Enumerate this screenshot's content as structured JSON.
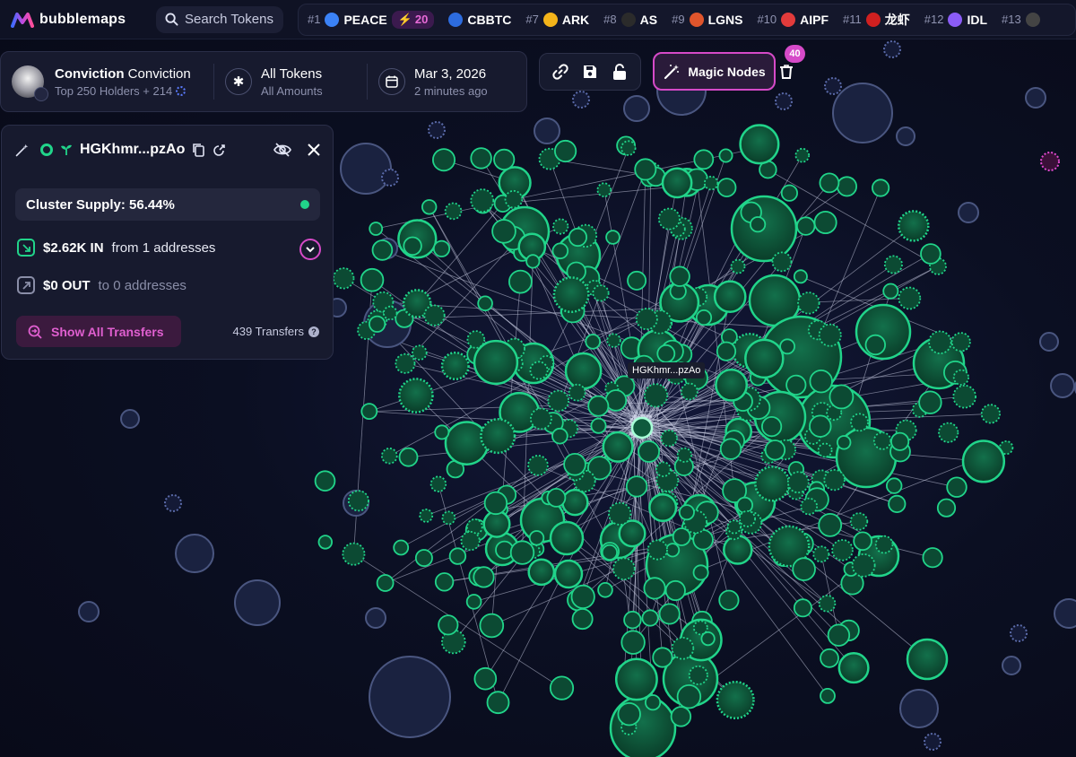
{
  "app": {
    "name": "bubblemaps"
  },
  "search": {
    "label": "Search Tokens"
  },
  "rankings": [
    {
      "rank": "#1",
      "symbol": "PEACE",
      "icon": "peace-token-icon",
      "color": "#3b82f6",
      "hot": "20"
    },
    {
      "rank": "",
      "symbol": "CBBTC",
      "icon": "cbbtc-token-icon",
      "color": "#2d6cdf"
    },
    {
      "rank": "#7",
      "symbol": "ARK",
      "icon": "ark-token-icon",
      "color": "#f4b41a"
    },
    {
      "rank": "#8",
      "symbol": "AS",
      "icon": "as-token-icon",
      "color": "#2b2b2b"
    },
    {
      "rank": "#9",
      "symbol": "LGNS",
      "icon": "lgns-token-icon",
      "color": "#e0552c"
    },
    {
      "rank": "#10",
      "symbol": "AIPF",
      "icon": "aipf-token-icon",
      "color": "#e23b3b"
    },
    {
      "rank": "#11",
      "symbol": "龙虾",
      "icon": "lobster-token-icon",
      "color": "#d02020"
    },
    {
      "rank": "#12",
      "symbol": "IDL",
      "icon": "idl-token-icon",
      "color": "#8b5cf6"
    },
    {
      "rank": "#13",
      "symbol": "",
      "icon": "token-icon",
      "color": "#444"
    }
  ],
  "header": {
    "token_name": "Conviction",
    "token_ticker": "Conviction",
    "holders": "Top 250 Holders + 214",
    "filter_title": "All Tokens",
    "filter_sub": "All Amounts",
    "date": "Mar 3, 2026",
    "updated": "2 minutes ago"
  },
  "magic": {
    "label": "Magic Nodes",
    "count": "40"
  },
  "panel": {
    "address": "HGKhmr...pzAo",
    "supply": "Cluster Supply: 56.44%",
    "in_amount": "$2.62K IN",
    "in_text": "from 1 addresses",
    "out_amount": "$0 OUT",
    "out_text": "to 0 addresses",
    "show_label": "Show All Transfers",
    "transfers": "439 Transfers"
  },
  "node_label": "HGKhmr...pzAo",
  "colors": {
    "accent": "#d64ac8",
    "green": "#21d48a",
    "green_fill": "#0c4a33",
    "blue_fill": "#1a2240",
    "blue_stroke": "#4a5680",
    "background": "#0a0d1c"
  }
}
